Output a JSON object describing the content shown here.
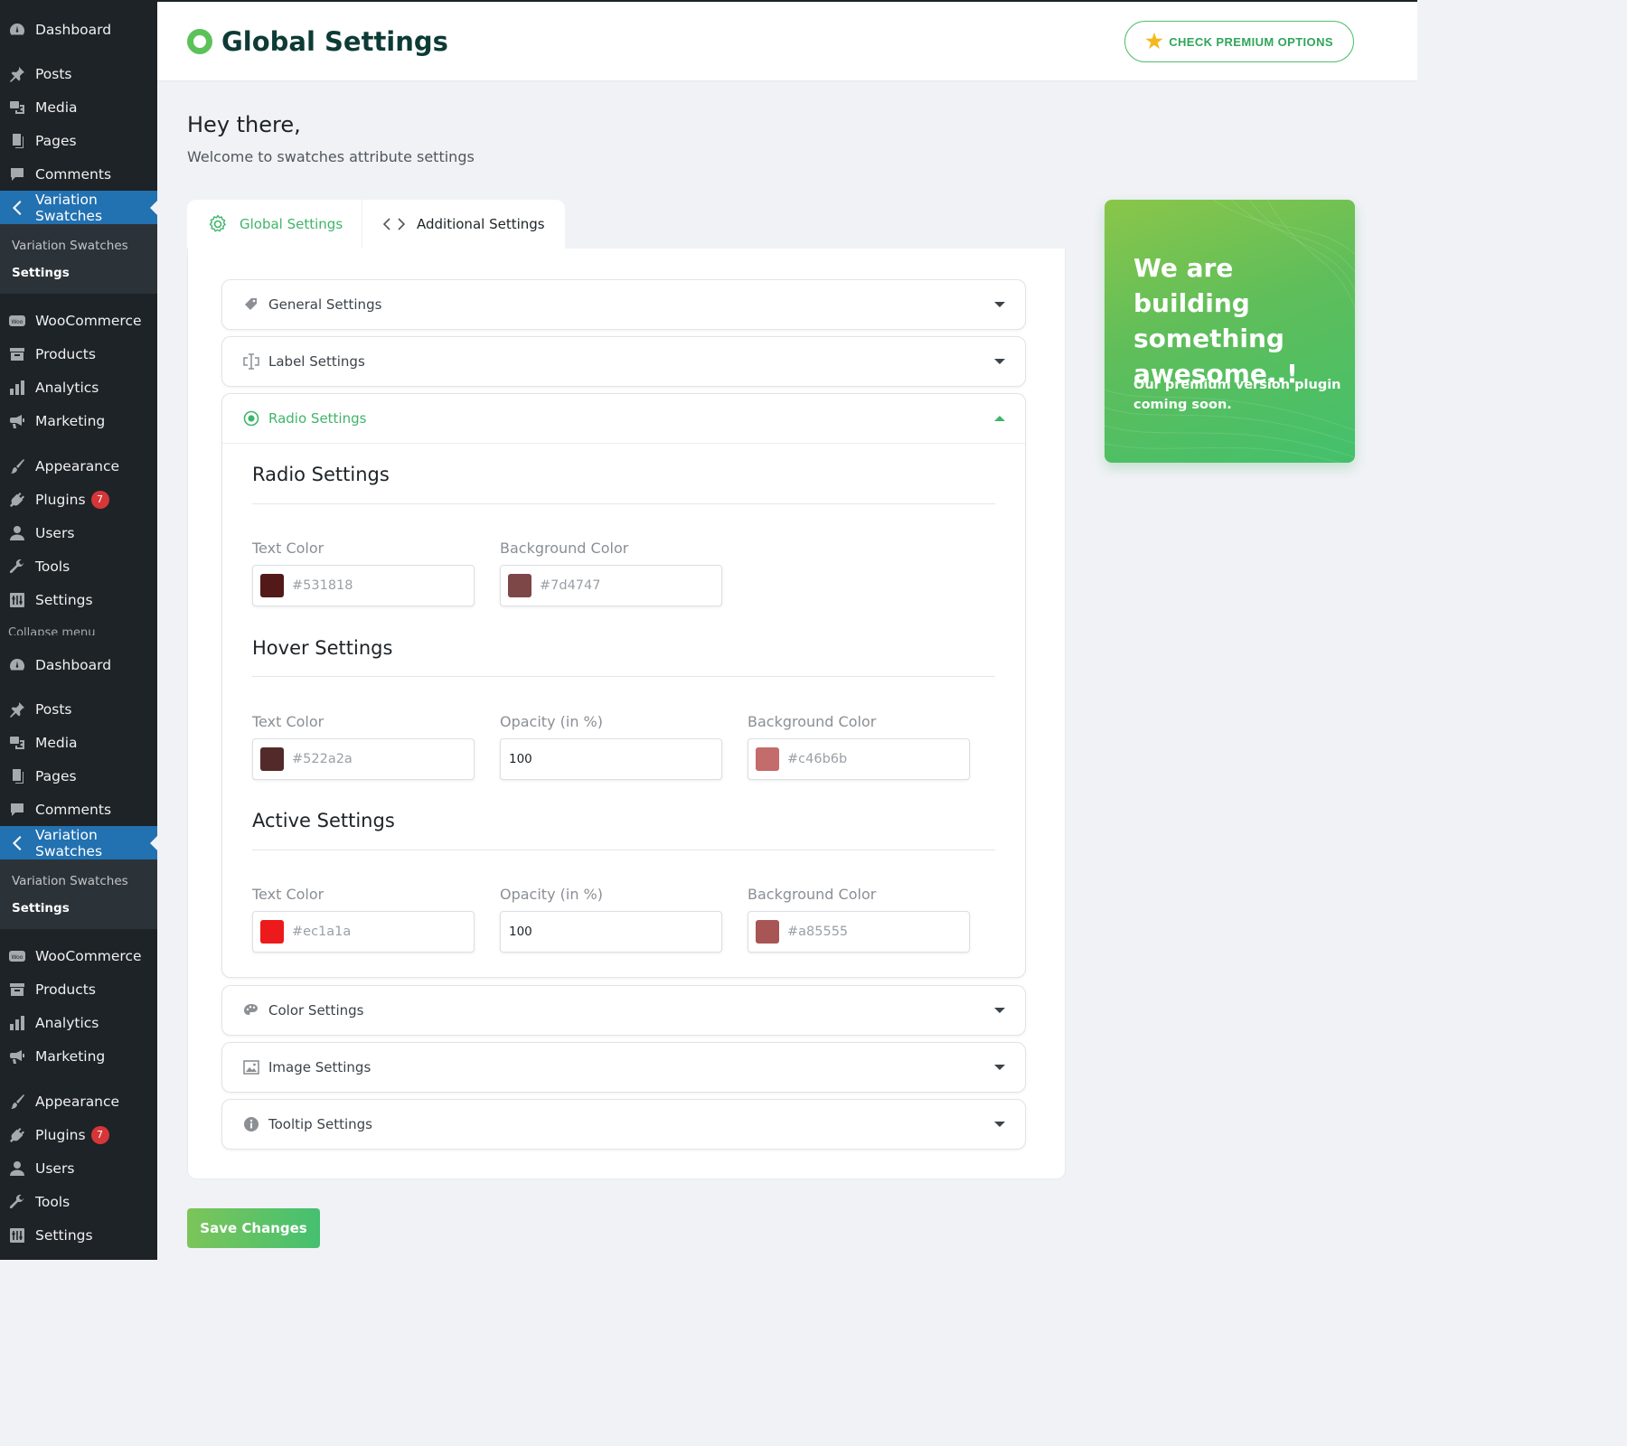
{
  "sidebar": {
    "items": [
      {
        "label": "Dashboard",
        "icon": "dashboard-icon"
      },
      {
        "label": "Posts",
        "icon": "pin-icon"
      },
      {
        "label": "Media",
        "icon": "media-icon"
      },
      {
        "label": "Pages",
        "icon": "pages-icon"
      },
      {
        "label": "Comments",
        "icon": "comment-icon"
      },
      {
        "label": "Variation Swatches",
        "icon": "chevron-left-icon"
      },
      {
        "label": "WooCommerce",
        "icon": "woo-icon"
      },
      {
        "label": "Products",
        "icon": "archive-icon"
      },
      {
        "label": "Analytics",
        "icon": "chart-bar-icon"
      },
      {
        "label": "Marketing",
        "icon": "megaphone-icon"
      },
      {
        "label": "Appearance",
        "icon": "brush-icon"
      },
      {
        "label": "Plugins",
        "icon": "plugin-icon",
        "badge": "7"
      },
      {
        "label": "Users",
        "icon": "user-icon"
      },
      {
        "label": "Tools",
        "icon": "wrench-icon"
      },
      {
        "label": "Settings",
        "icon": "settings-icon"
      }
    ],
    "submenu": {
      "parent": "Variation Swatches",
      "current": "Settings"
    },
    "collapse_label": "Collapse menu"
  },
  "header": {
    "title": "Global Settings",
    "premium_button": "CHECK PREMIUM OPTIONS"
  },
  "intro": {
    "greeting": "Hey there,",
    "welcome": "Welcome to swatches attribute settings"
  },
  "tabs": {
    "global": "Global Settings",
    "additional": "Additional Settings"
  },
  "accordions": {
    "general": "General Settings",
    "label": "Label Settings",
    "radio": "Radio Settings",
    "color": "Color Settings",
    "image": "Image Settings",
    "tooltip": "Tooltip Settings"
  },
  "radio": {
    "title": "Radio Settings",
    "text_color_label": "Text Color",
    "text_color": "#531818",
    "bg_color_label": "Background Color",
    "bg_color": "#7d4747"
  },
  "hover": {
    "title": "Hover Settings",
    "text_color_label": "Text Color",
    "text_color": "#522a2a",
    "opacity_label": "Opacity (in %)",
    "opacity": "100",
    "bg_color_label": "Background Color",
    "bg_color": "#c46b6b"
  },
  "active": {
    "title": "Active Settings",
    "text_color_label": "Text Color",
    "text_color": "#ec1a1a",
    "opacity_label": "Opacity (in %)",
    "opacity": "100",
    "bg_color_label": "Background Color",
    "bg_color": "#a85555"
  },
  "promo": {
    "heading": "We are building something awesome..!",
    "text": "Our premium version plugin coming soon."
  },
  "save_button": "Save Changes",
  "colors": {
    "sidebar_bg": "#1d2327",
    "active_menu": "#2271b1",
    "accent_green": "#3fb569",
    "badge_red": "#d63638"
  }
}
